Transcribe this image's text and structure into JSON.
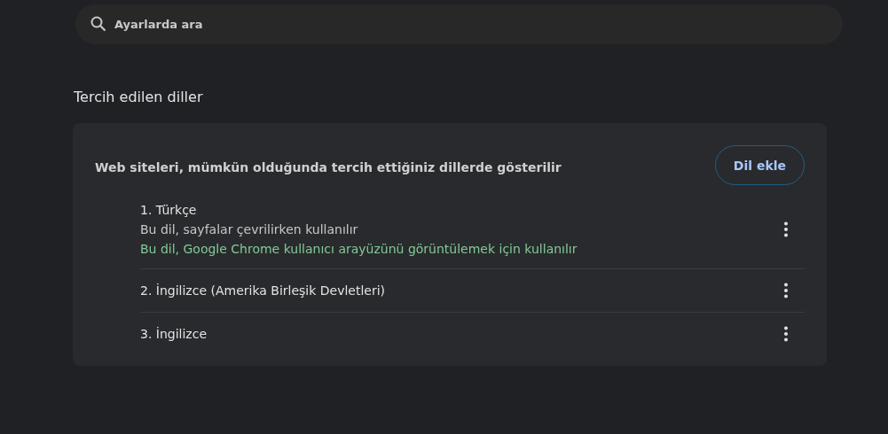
{
  "search": {
    "placeholder": "Ayarlarda ara"
  },
  "section_title": "Tercih edilen diller",
  "card": {
    "description": "Web siteleri, mümkün olduğunda tercih ettiğiniz dillerde gösterilir",
    "add_button": "Dil ekle",
    "languages": [
      {
        "label": "1. Türkçe",
        "notes": [
          {
            "kind": "plain",
            "text": "Bu dil, sayfalar çevrilirken kullanılır"
          },
          {
            "kind": "ui",
            "text": "Bu dil, Google Chrome kullanıcı arayüzünü görüntülemek için kullanılır"
          }
        ]
      },
      {
        "label": "2. İngilizce (Amerika Birleşik Devletleri)"
      },
      {
        "label": "3. İngilizce"
      }
    ]
  }
}
